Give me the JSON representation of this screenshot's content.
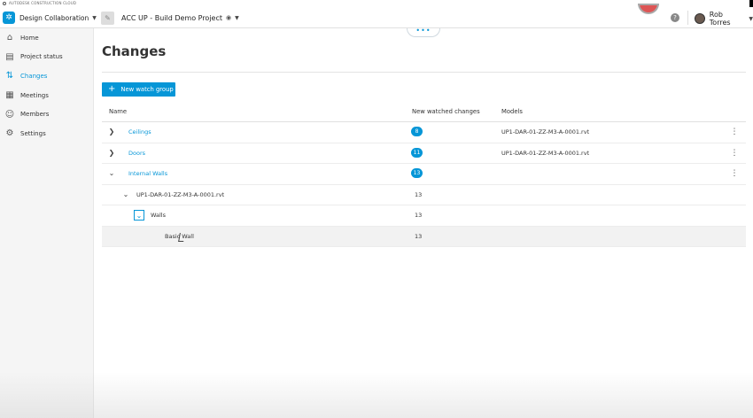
{
  "brand": {
    "text": "AUTODESK CONSTRUCTION CLOUD"
  },
  "topbar": {
    "app_name": "Design Collaboration",
    "project_name": "ACC UP - Build Demo Project",
    "user_name": "Rob Torres",
    "help_glyph": "?"
  },
  "sidebar": {
    "items": [
      {
        "label": "Home",
        "icon": "home-icon",
        "glyph": "⌂",
        "active": false
      },
      {
        "label": "Project status",
        "icon": "status-icon",
        "glyph": "▤",
        "active": false
      },
      {
        "label": "Changes",
        "icon": "changes-icon",
        "glyph": "⇅",
        "active": true
      },
      {
        "label": "Meetings",
        "icon": "meetings-icon",
        "glyph": "▦",
        "active": false
      },
      {
        "label": "Members",
        "icon": "members-icon",
        "glyph": "☺",
        "active": false
      },
      {
        "label": "Settings",
        "icon": "settings-icon",
        "glyph": "⚙",
        "active": false
      }
    ]
  },
  "main": {
    "more_glyph": "•••",
    "title": "Changes",
    "new_button_label": "New watch group",
    "columns": {
      "name": "Name",
      "changes": "New watched changes",
      "models": "Models"
    },
    "rows": [
      {
        "name": "Ceilings",
        "count": "8",
        "model": "UP1-DAR-01-ZZ-M3-A-0001.rvt"
      },
      {
        "name": "Doors",
        "count": "11",
        "model": "UP1-DAR-01-ZZ-M3-A-0001.rvt"
      },
      {
        "name": "Internal Walls",
        "count": "13",
        "model": ""
      },
      {
        "name": "UP1-DAR-01-ZZ-M3-A-0001.rvt",
        "count": "13"
      },
      {
        "name": "Walls",
        "count": "13"
      },
      {
        "name": "Basic Wall",
        "count": "13"
      }
    ]
  },
  "colors": {
    "accent": "#0696d7",
    "sidebar_bg": "#f5f5f5"
  }
}
